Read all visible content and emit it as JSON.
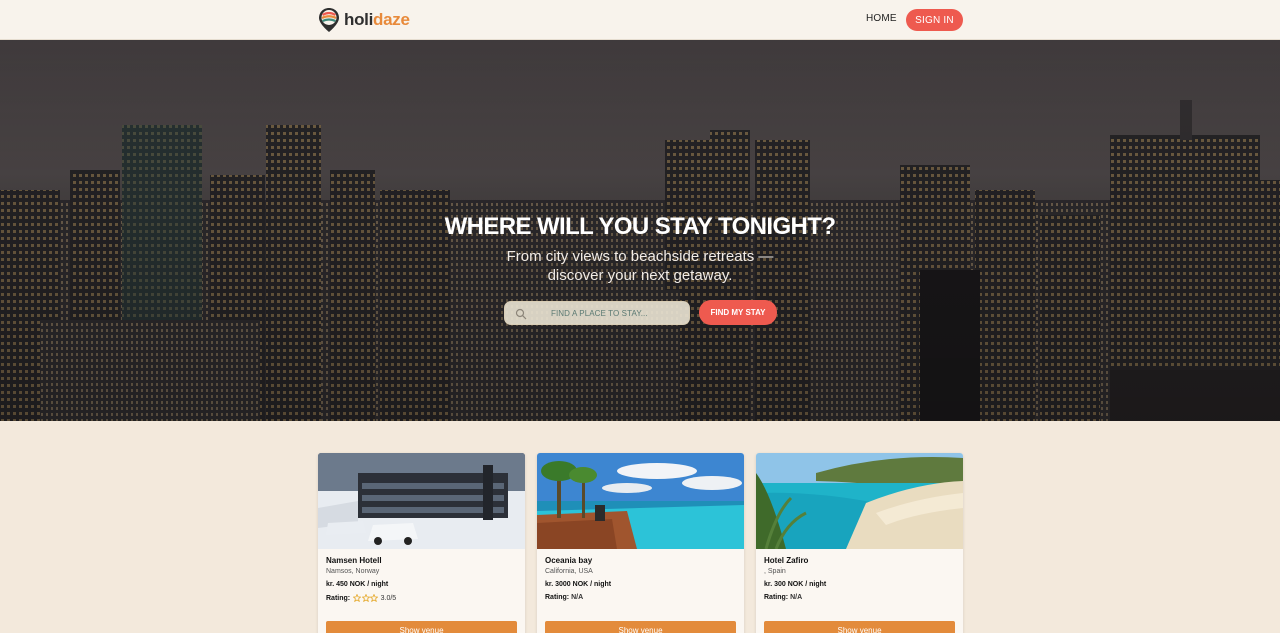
{
  "header": {
    "logo_part1": "holi",
    "logo_part2": "daze",
    "nav_home": "HOME",
    "sign_in": "SIGN IN"
  },
  "hero": {
    "title": "WHERE WILL YOU STAY TONIGHT?",
    "subtitle_line1": "From city views to beachside retreats —",
    "subtitle_line2": "discover your next getaway.",
    "search_placeholder": "FIND A PLACE TO STAY...",
    "find_button": "FIND MY STAY"
  },
  "venues": [
    {
      "name": "Namsen Hotell",
      "location": "Namsos, Norway",
      "price": "kr. 450 NOK / night",
      "rating_label": "Rating:",
      "rating_value": "3.0/5",
      "stars": 3,
      "button": "Show venue"
    },
    {
      "name": "Oceania bay",
      "location": "California, USA",
      "price": "kr. 3000 NOK / night",
      "rating_label": "Rating:",
      "rating_value": "N/A",
      "stars": 0,
      "button": "Show venue"
    },
    {
      "name": "Hotel Zafiro",
      "location": ", Spain",
      "price": "kr. 300 NOK / night",
      "rating_label": "Rating:",
      "rating_value": "N/A",
      "stars": 0,
      "button": "Show venue"
    }
  ],
  "colors": {
    "accent": "#ee5a4f",
    "button_orange": "#e38b3b",
    "page_bg": "#f3e9dc"
  }
}
